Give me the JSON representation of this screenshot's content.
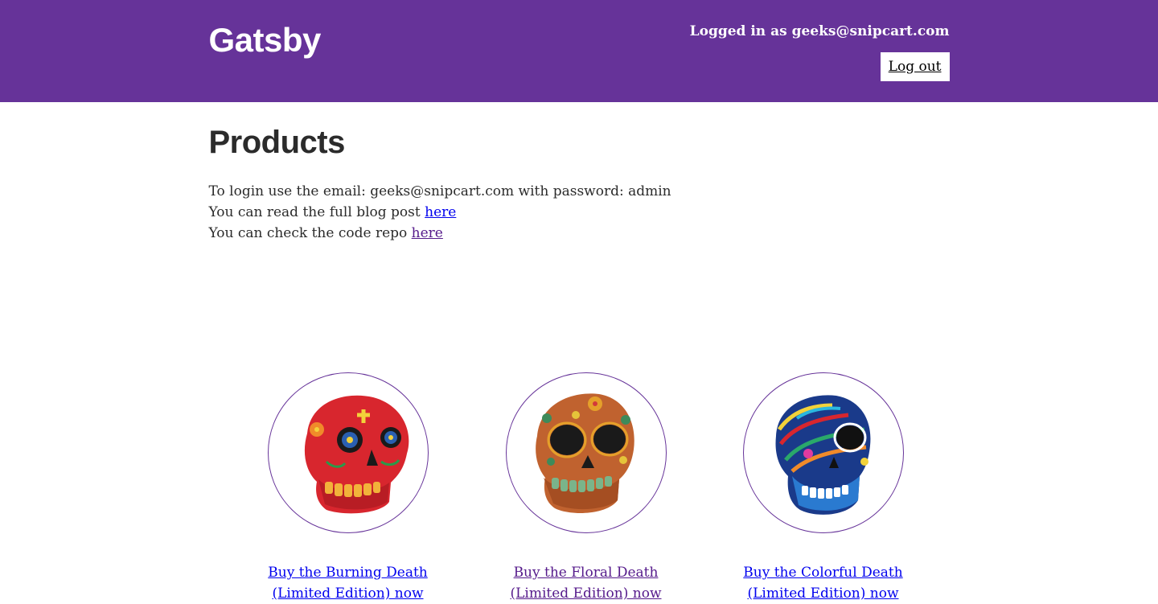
{
  "header": {
    "brand": "Gatsby",
    "logged_in_text": "Logged in as geeks@snipcart.com",
    "logout_label": "Log out",
    "background_color": "#663399"
  },
  "main": {
    "title": "Products",
    "intro": {
      "line1": "To login use the email: geeks@snipcart.com with password: admin",
      "line2_prefix": "You can read the full blog post ",
      "line2_link": "here",
      "line3_prefix": "You can check the code repo ",
      "line3_link": "here"
    },
    "products": [
      {
        "icon": "red-skull-image",
        "link_line1": "Buy the Burning Death",
        "link_line2": "(Limited Edition) now"
      },
      {
        "icon": "floral-skull-image",
        "link_line1": "Buy the Floral Death",
        "link_line2": "(Limited Edition) now"
      },
      {
        "icon": "colorful-skull-image",
        "link_line1": "Buy the Colorful Death",
        "link_line2": "(Limited Edition) now"
      }
    ]
  }
}
